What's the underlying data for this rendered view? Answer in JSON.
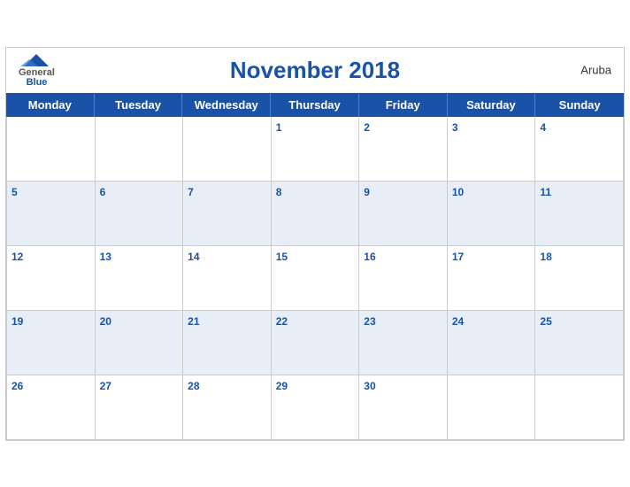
{
  "header": {
    "title": "November 2018",
    "country": "Aruba",
    "logo": {
      "general": "General",
      "blue": "Blue"
    }
  },
  "days": [
    "Monday",
    "Tuesday",
    "Wednesday",
    "Thursday",
    "Friday",
    "Saturday",
    "Sunday"
  ],
  "weeks": [
    [
      null,
      null,
      null,
      1,
      2,
      3,
      4
    ],
    [
      5,
      6,
      7,
      8,
      9,
      10,
      11
    ],
    [
      12,
      13,
      14,
      15,
      16,
      17,
      18
    ],
    [
      19,
      20,
      21,
      22,
      23,
      24,
      25
    ],
    [
      26,
      27,
      28,
      29,
      30,
      null,
      null
    ]
  ]
}
